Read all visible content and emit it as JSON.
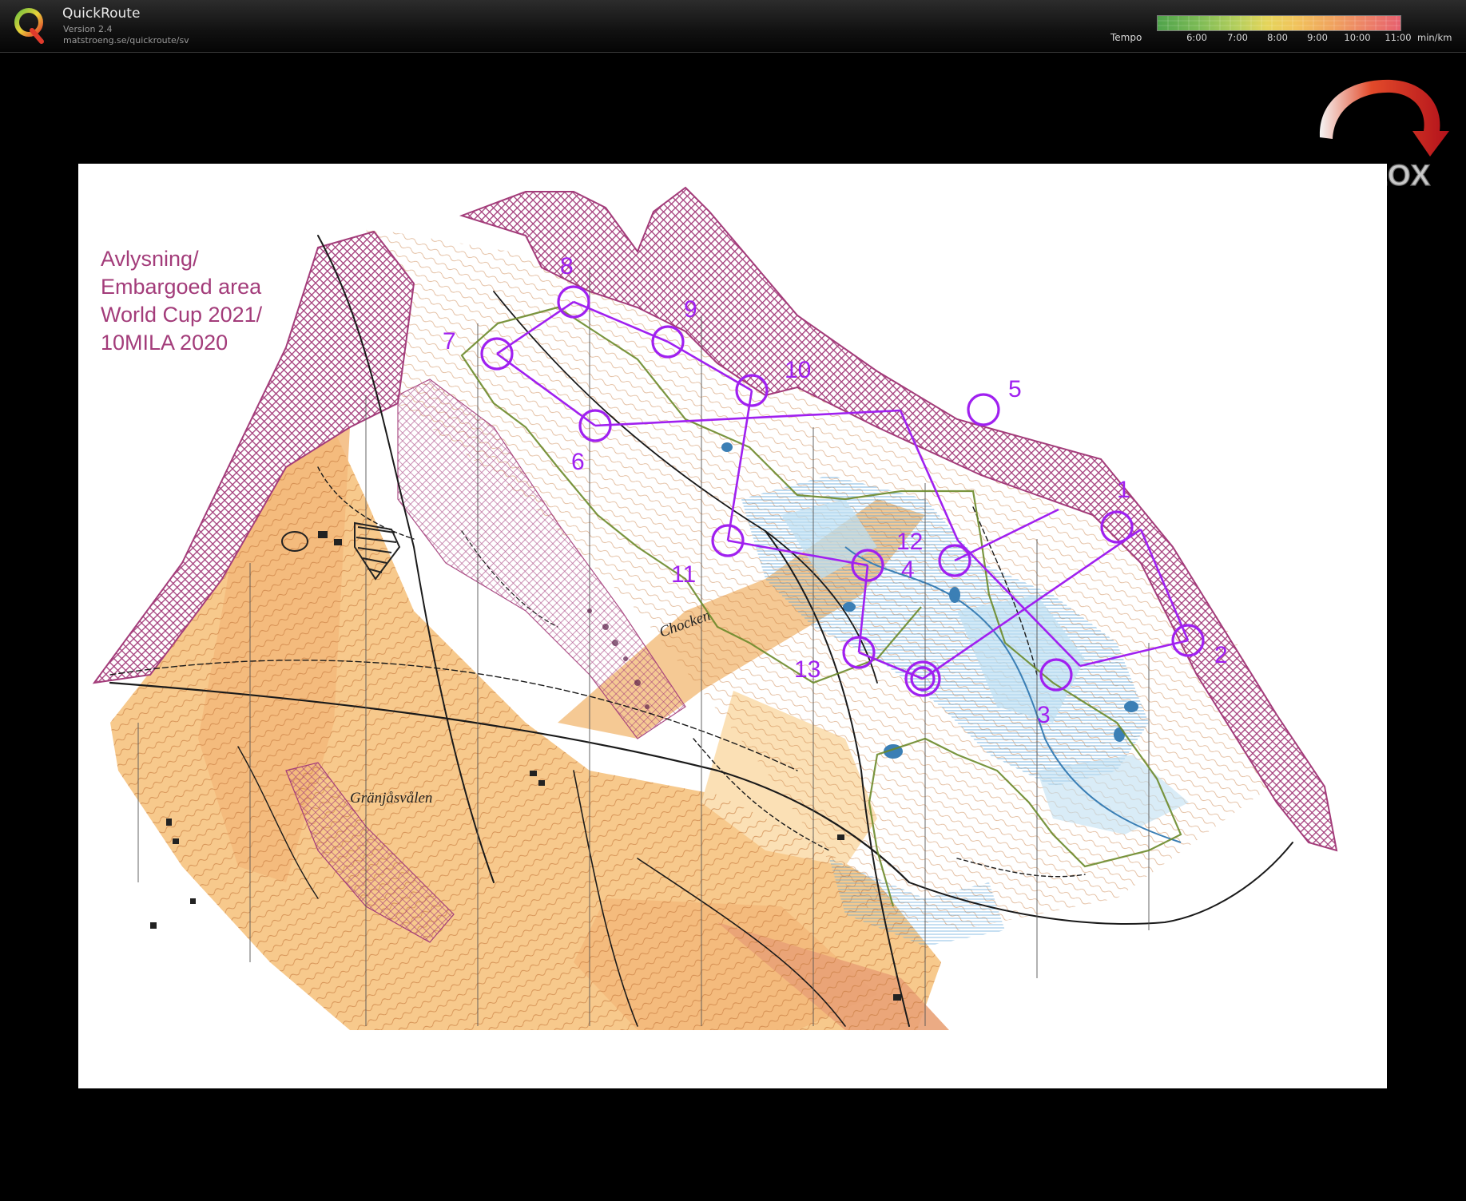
{
  "app": {
    "title": "QuickRoute",
    "version": "Version 2.4",
    "url": "matstroeng.se/quickroute/sv",
    "logo_icon": "quickroute-q-logo"
  },
  "legend": {
    "label": "Tempo",
    "ticks": [
      "6:00",
      "7:00",
      "8:00",
      "9:00",
      "10:00",
      "11:00"
    ],
    "unit": "min/km",
    "colors": [
      "#4fa34b",
      "#b6cf5c",
      "#e5d55b",
      "#f0a35e",
      "#e65f6e"
    ]
  },
  "watermark": {
    "text": "LIVELOX",
    "icon": "livelox-arrow-icon"
  },
  "map": {
    "embargo_note": [
      "Avlysning/",
      "Embargoed area",
      "World Cup 2021/",
      "10MILA 2020"
    ],
    "place_names": [
      "Gränjåsvålen",
      "Chocken"
    ],
    "course_color": "#a020f0",
    "embargo_color": "#a33c7a",
    "controls": [
      {
        "label": "1"
      },
      {
        "label": "2"
      },
      {
        "label": "3"
      },
      {
        "label": "4"
      },
      {
        "label": "5"
      },
      {
        "label": "6"
      },
      {
        "label": "7"
      },
      {
        "label": "8"
      },
      {
        "label": "9"
      },
      {
        "label": "10"
      },
      {
        "label": "11"
      },
      {
        "label": "12"
      },
      {
        "label": "13"
      }
    ]
  }
}
